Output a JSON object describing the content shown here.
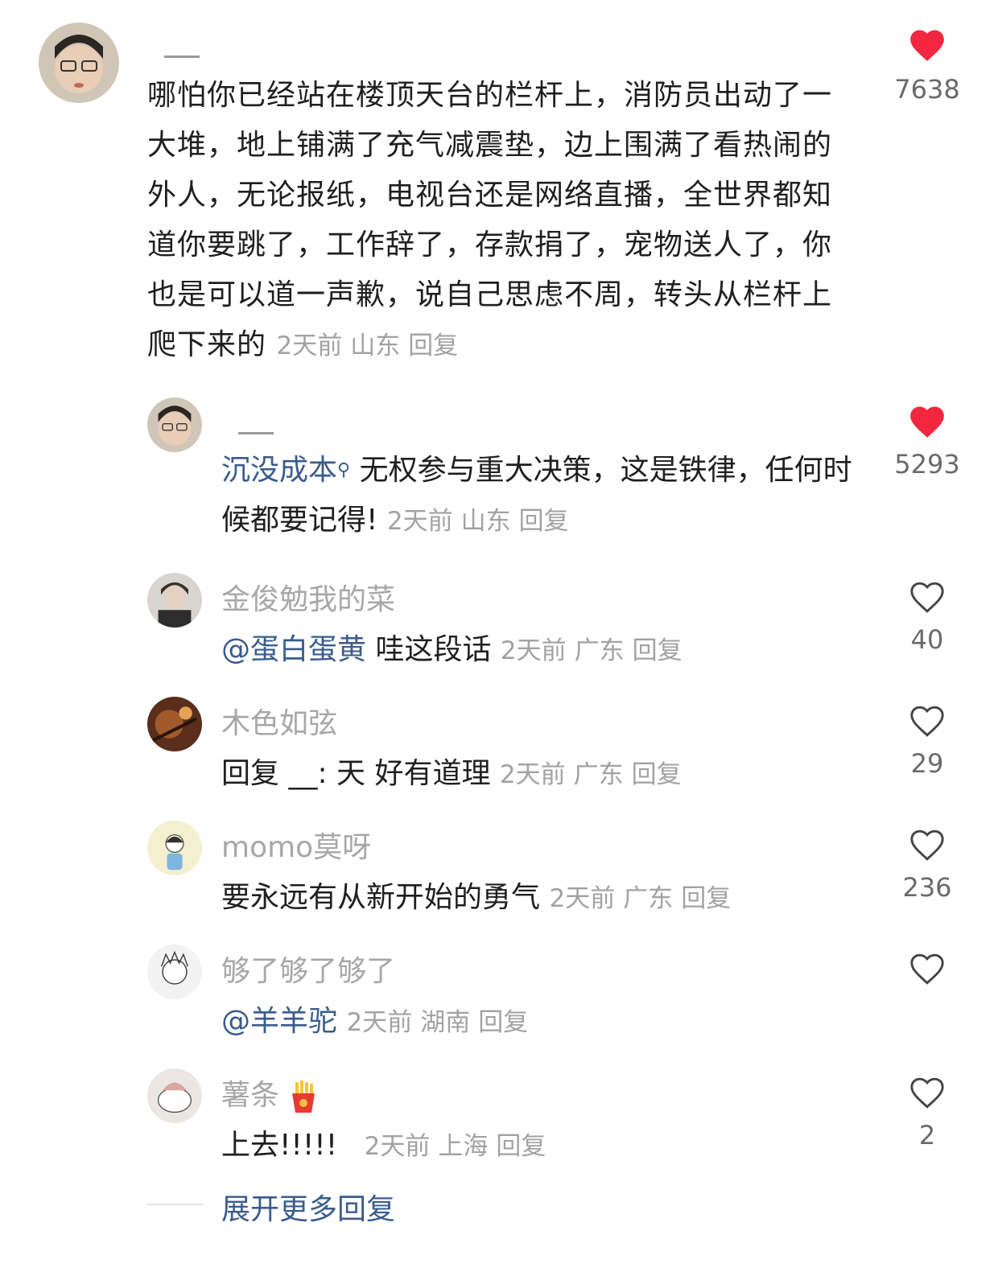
{
  "main_comment": {
    "username": "__",
    "text": "哪怕你已经站在楼顶天台的栏杆上，消防员出动了一大堆，地上铺满了充气减震垫，边上围满了看热闹的外人，无论报纸，电视台还是网络直播，全世界都知道你要跳了，工作辞了，存款捐了，宠物送人了，你也是可以道一声歉，说自己思虑不周，转头从栏杆上爬下来的",
    "time": "2天前",
    "location": "山东",
    "reply_label": "回复",
    "likes": "7638",
    "liked": true
  },
  "replies": [
    {
      "username": "__",
      "mention": "沉没成本",
      "text": " 无权参与重大决策，这是铁律，任何时候都要记得!",
      "time": "2天前",
      "location": "山东",
      "reply_label": "回复",
      "likes": "5293",
      "liked": true
    },
    {
      "username": "金俊勉我的菜",
      "mention": "@蛋白蛋黄",
      "text": " 哇这段话",
      "time": "2天前",
      "location": "广东",
      "reply_label": "回复",
      "likes": "40",
      "liked": false
    },
    {
      "username": "木色如弦",
      "mention": "",
      "text": "回复 __: 天 好有道理",
      "time": "2天前",
      "location": "广东",
      "reply_label": "回复",
      "likes": "29",
      "liked": false
    },
    {
      "username": "momo莫呀",
      "mention": "",
      "text": "要永远有从新开始的勇气",
      "time": "2天前",
      "location": "广东",
      "reply_label": "回复",
      "likes": "236",
      "liked": false
    },
    {
      "username": "够了够了够了",
      "mention": "@羊羊驼",
      "text": "",
      "time": "2天前",
      "location": "湖南",
      "reply_label": "回复",
      "likes": "",
      "liked": false
    },
    {
      "username": "薯条",
      "mention": "",
      "text": "上去!!!!!",
      "time": "2天前",
      "location": "上海",
      "reply_label": "回复",
      "likes": "2",
      "liked": false
    }
  ],
  "expand_label": "展开更多回复",
  "colors": {
    "heart_red": "#f2263f",
    "mention_blue": "#3a5c8c",
    "meta_gray": "#a2a2a2"
  }
}
